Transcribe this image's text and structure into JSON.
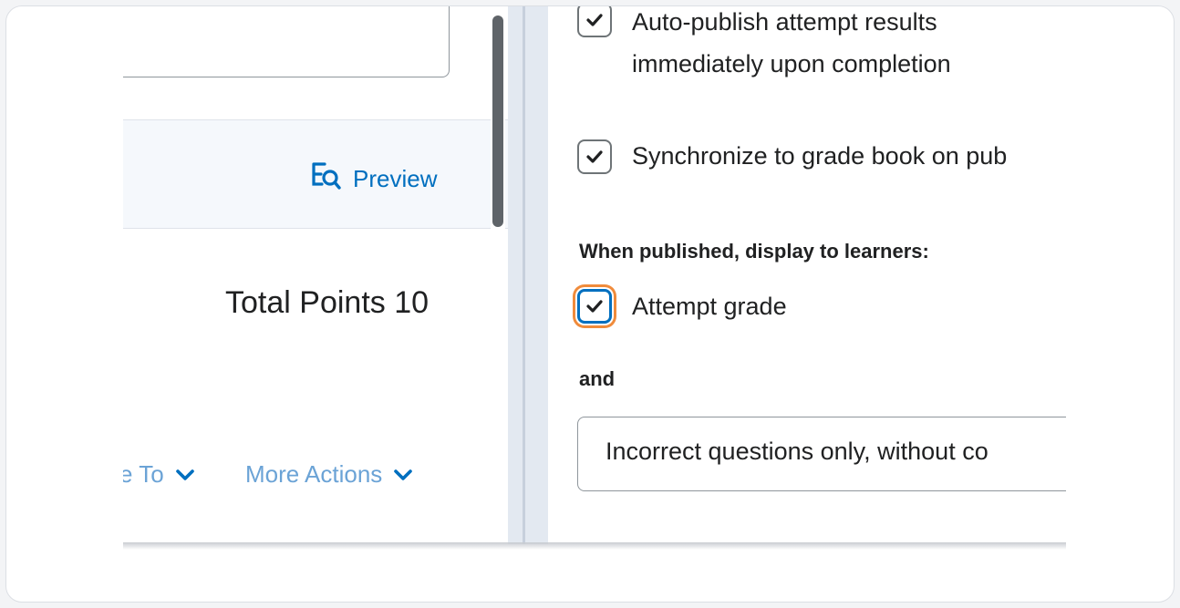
{
  "left": {
    "preview_label": "Preview",
    "total_points": "Total Points 10",
    "move_to_label": "e To",
    "more_actions_label": "More Actions"
  },
  "right": {
    "auto_publish_label_line1": "Auto-publish attempt results",
    "auto_publish_label_line2": "immediately upon completion",
    "sync_label": "Synchronize to grade book on pub",
    "display_heading": "When published, display to learners:",
    "attempt_grade_label": "Attempt grade",
    "and_label": "and",
    "select_value": "Incorrect questions only, without co"
  },
  "colors": {
    "link": "#006fbf",
    "focus_ring": "#f08b3b",
    "muted_link": "#6ba3d6"
  },
  "icons": {
    "preview": "preview-magnifier-icon",
    "check": "checkmark-icon",
    "chevron": "chevron-down-icon"
  }
}
